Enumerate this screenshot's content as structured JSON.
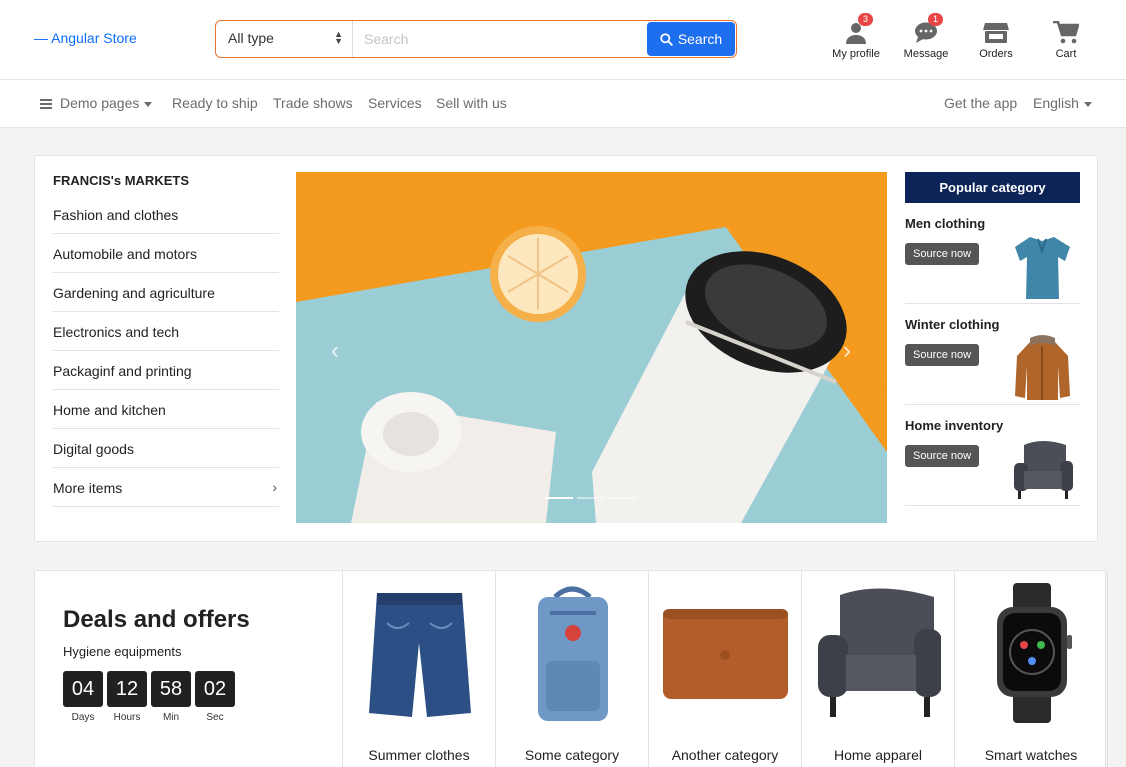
{
  "brand": "— Angular Store",
  "search": {
    "type_selected": "All type",
    "placeholder": "Search",
    "button_label": "Search"
  },
  "header_icons": [
    {
      "label": "My profile",
      "badge": "3",
      "icon": "user-icon"
    },
    {
      "label": "Message",
      "badge": "1",
      "icon": "message-icon"
    },
    {
      "label": "Orders",
      "badge": "",
      "icon": "store-icon"
    },
    {
      "label": "Cart",
      "badge": "",
      "icon": "cart-icon"
    }
  ],
  "nav": {
    "demo": "Demo pages",
    "items": [
      "Ready to ship",
      "Trade shows",
      "Services",
      "Sell with us"
    ],
    "get_app": "Get the app",
    "language": "English"
  },
  "market": {
    "title": "FRANCIS's MARKETS",
    "categories": [
      "Fashion and clothes",
      "Automobile and motors",
      "Gardening and agriculture",
      "Electronics and tech",
      "Packaginf and printing",
      "Home and kitchen",
      "Digital goods",
      "More items"
    ]
  },
  "slider": {
    "active_slide": 1,
    "slide_count": 3
  },
  "popular": {
    "title": "Popular category",
    "items": [
      {
        "title": "Men clothing",
        "button": "Source now"
      },
      {
        "title": "Winter clothing",
        "button": "Source now"
      },
      {
        "title": "Home inventory",
        "button": "Source now"
      }
    ]
  },
  "deals": {
    "title": "Deals and offers",
    "subtitle": "Hygiene equipments",
    "timer": [
      {
        "value": "04",
        "unit": "Days"
      },
      {
        "value": "12",
        "unit": "Hours"
      },
      {
        "value": "58",
        "unit": "Min"
      },
      {
        "value": "02",
        "unit": "Sec"
      }
    ],
    "items": [
      "Summer clothes",
      "Some category",
      "Another category",
      "Home apparel",
      "Smart watches"
    ]
  },
  "colors": {
    "accent": "#1e6ef0",
    "search_border": "#e8732c",
    "popular_head": "#0d2459",
    "badge": "#e84545",
    "slider_bg": "#f39a1f"
  }
}
